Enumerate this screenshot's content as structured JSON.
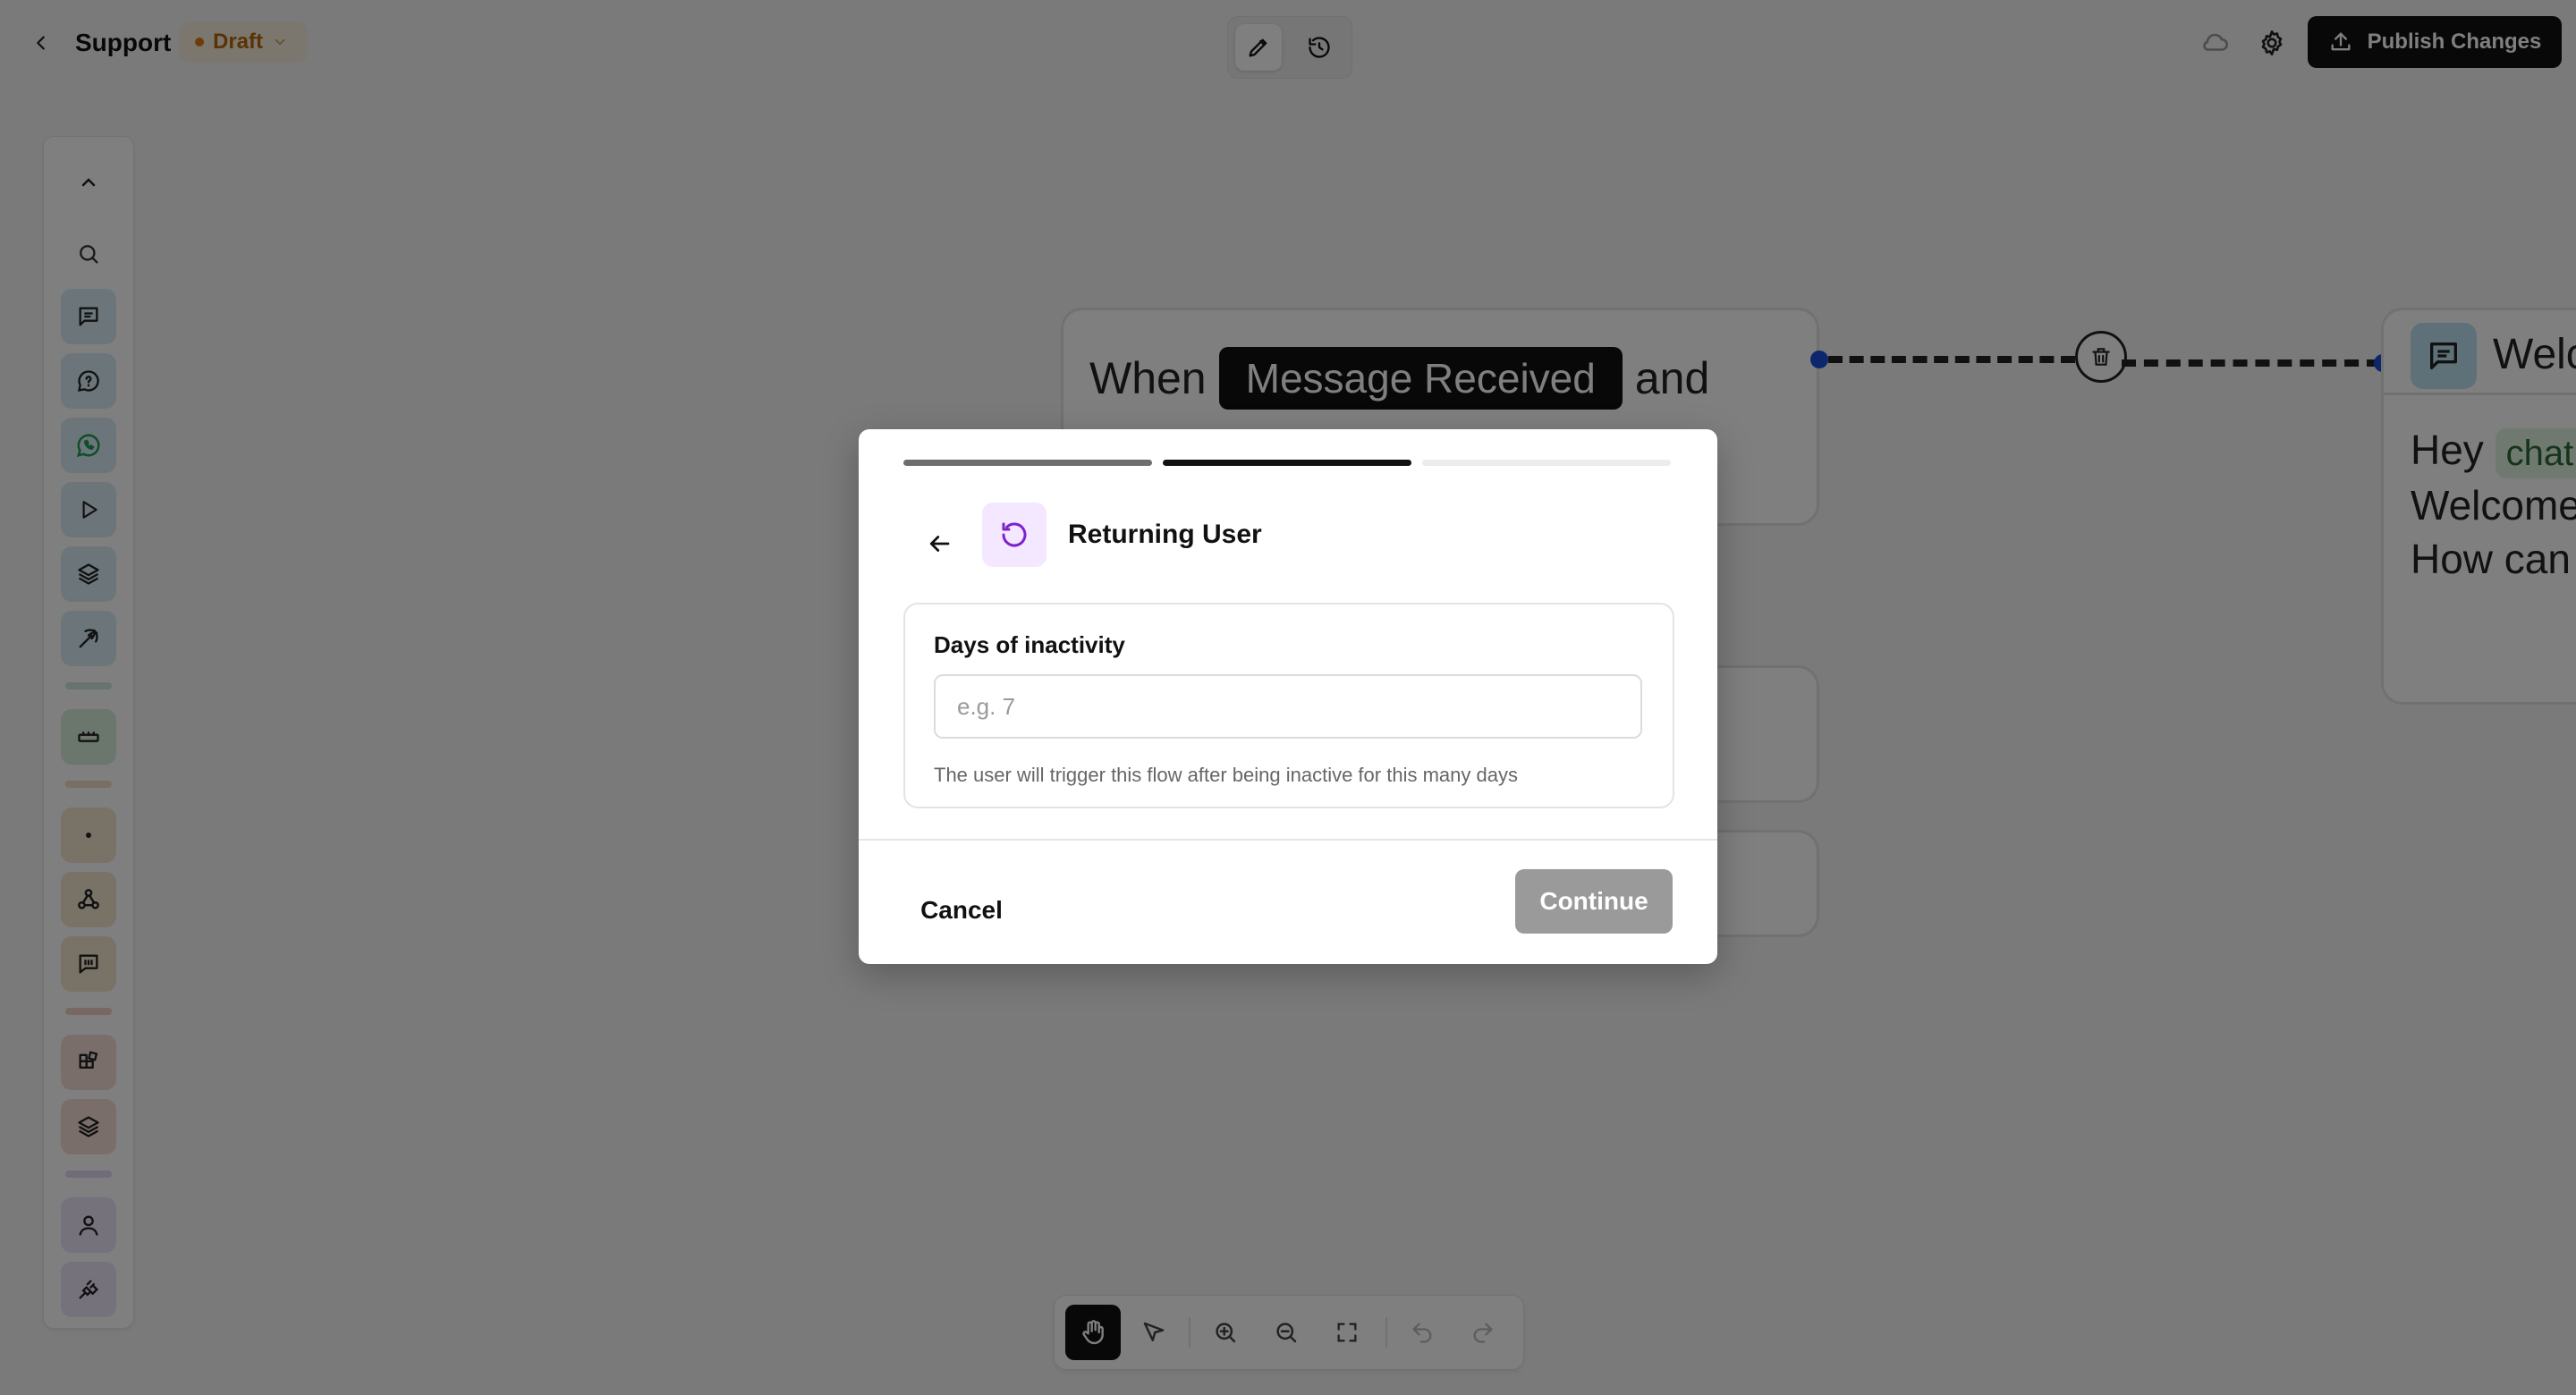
{
  "header": {
    "flow_name": "Support",
    "status": "Draft",
    "publish_label": "Publish Changes",
    "colors": {
      "status_text": "#b4650a",
      "status_bg": "#f6eedc",
      "publish_bg": "#111111"
    }
  },
  "sidebar": {
    "icons": [
      "chevron-up-icon",
      "search-icon",
      "message-icon",
      "chat-bubble-question-icon",
      "whatsapp-icon",
      "play-icon",
      "layers-icon",
      "pick-icon",
      "keyboard-icon",
      "dot-icon",
      "webhook-icon",
      "message-square-icon",
      "integration-icon",
      "stack-icon",
      "user-icon",
      "plug-icon"
    ]
  },
  "canvas": {
    "trigger": {
      "prefix": "When",
      "event": "Message Received",
      "suffix": "and"
    },
    "message_node": {
      "title": "Welc",
      "greeting": "Hey",
      "variable": "chat.",
      "line2": "Welcome",
      "line3": "How can "
    }
  },
  "toolbar": {
    "tools": [
      "hand-icon",
      "pointer-icon",
      "zoom-in-icon",
      "zoom-out-icon",
      "fit-screen-icon",
      "undo-icon",
      "redo-icon"
    ],
    "active": "hand-icon"
  },
  "modal": {
    "progress": {
      "steps": 3,
      "current": 2
    },
    "title": "Returning User",
    "field": {
      "label": "Days of inactivity",
      "value": "",
      "placeholder": "e.g. 7",
      "help": "The user will trigger this flow after being inactive for this many days"
    },
    "cancel_label": "Cancel",
    "continue_label": "Continue",
    "colors": {
      "icon_bg": "#f3e8ff",
      "icon": "#7e22ce",
      "continue_disabled": "#9a9a9a"
    }
  }
}
